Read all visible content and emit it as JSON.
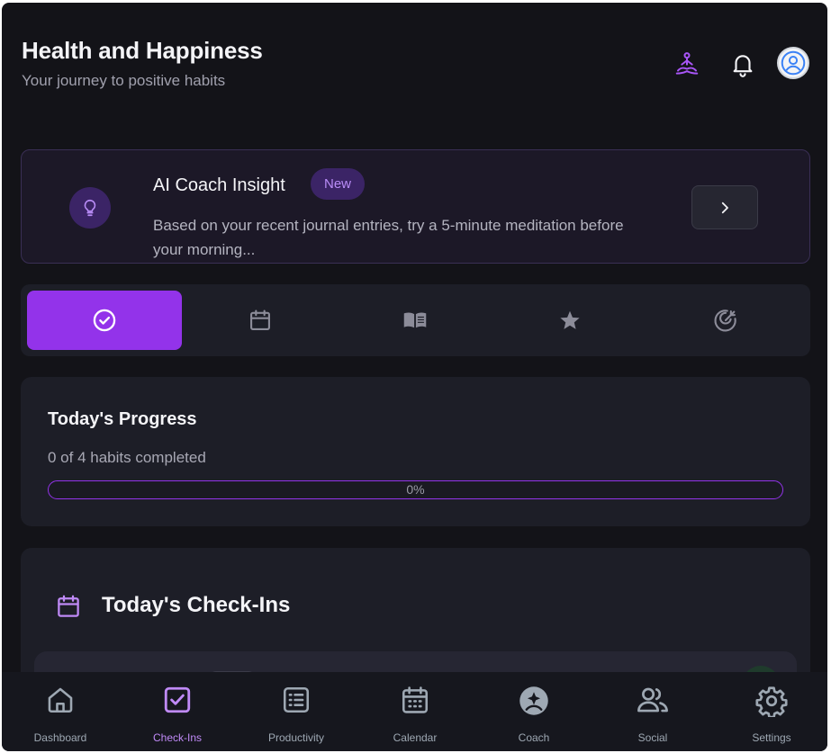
{
  "header": {
    "title": "Health and Happiness",
    "subtitle": "Your journey to positive habits",
    "icons": [
      "meditation-icon",
      "bell-icon",
      "user-avatar-icon"
    ]
  },
  "insight": {
    "title": "AI Coach Insight",
    "badge": "New",
    "text": "Based on your recent journal entries, try a 5-minute meditation before your morning...",
    "icon": "lightbulb-icon",
    "action_icon": "chevron-right-icon"
  },
  "tabs": [
    {
      "icon": "check-circle-icon",
      "active": true
    },
    {
      "icon": "calendar-icon",
      "active": false
    },
    {
      "icon": "book-icon",
      "active": false
    },
    {
      "icon": "star-icon",
      "active": false
    },
    {
      "icon": "target-icon",
      "active": false
    }
  ],
  "progress": {
    "title": "Today's Progress",
    "summary": "0 of 4 habits completed",
    "percent_label": "0%",
    "value": 0
  },
  "checkins": {
    "title": "Today's Check-Ins",
    "icon": "calendar-icon"
  },
  "nav": [
    {
      "label": "Dashboard",
      "icon": "home-icon",
      "active": false
    },
    {
      "label": "Check-Ins",
      "icon": "checkbox-icon",
      "active": true
    },
    {
      "label": "Productivity",
      "icon": "list-icon",
      "active": false
    },
    {
      "label": "Calendar",
      "icon": "calendar-icon",
      "active": false
    },
    {
      "label": "Coach",
      "icon": "coach-icon",
      "active": false
    },
    {
      "label": "Social",
      "icon": "users-icon",
      "active": false
    },
    {
      "label": "Settings",
      "icon": "gear-icon",
      "active": false
    }
  ],
  "colors": {
    "accent": "#9333ea",
    "accent_light": "#c08af7",
    "background": "#131318",
    "card": "#1d1e27"
  }
}
